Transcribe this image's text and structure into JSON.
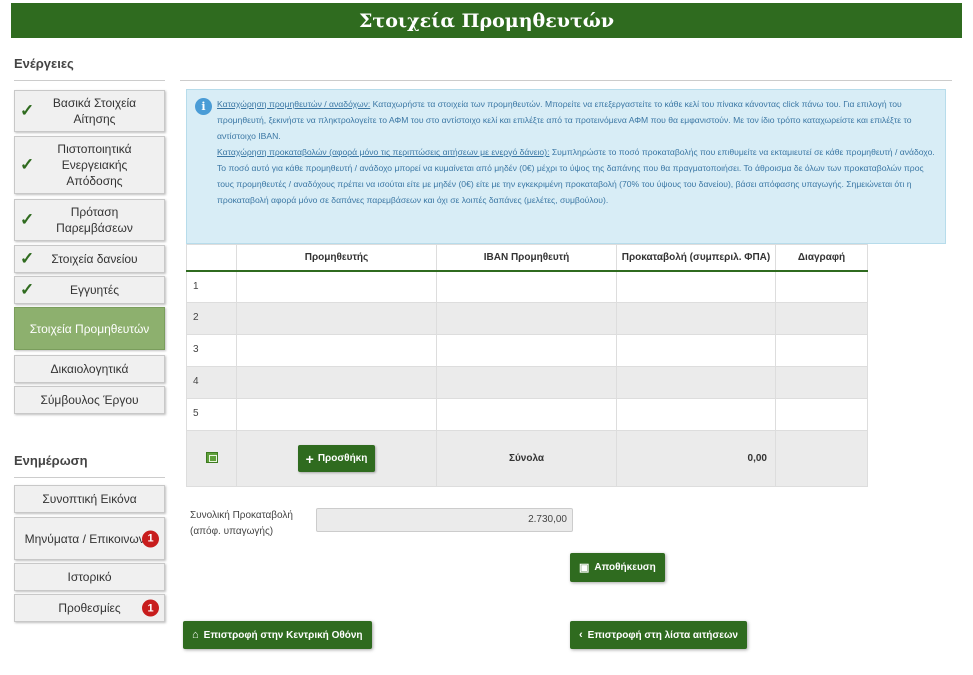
{
  "header": {
    "title": "Στοιχεία Προμηθευτών"
  },
  "sidebar": {
    "actions_title": "Ενέργειες",
    "actions": [
      {
        "label": "Βασικά Στοιχεία Αίτησης",
        "checked": true
      },
      {
        "label": "Πιστοποιητικά Ενεργειακής Απόδοσης",
        "checked": true
      },
      {
        "label": "Πρόταση Παρεμβάσεων",
        "checked": true
      },
      {
        "label": "Στοιχεία δανείου",
        "checked": true
      },
      {
        "label": "Εγγυητές",
        "checked": true
      },
      {
        "label": "Στοιχεία Προμηθευτών",
        "active": true
      },
      {
        "label": "Δικαιολογητικά"
      },
      {
        "label": "Σύμβουλος Έργου"
      }
    ],
    "info_title": "Ενημέρωση",
    "info_items": [
      {
        "label": "Συνοπτική Εικόνα"
      },
      {
        "label": "Μηνύματα / Επικοινωνία",
        "badge": "1"
      },
      {
        "label": "Ιστορικό"
      },
      {
        "label": "Προθεσμίες",
        "badge": "1"
      }
    ]
  },
  "info_box": {
    "p1_heading": "Καταχώρηση προμηθευτών / αναδόχων:",
    "p1_text": " Καταχωρήστε τα στοιχεία των προμηθευτών. Μπορείτε να επεξεργαστείτε το κάθε κελί του πίνακα κάνοντας click πάνω του. Για επιλογή του προμηθευτή, ξεκινήστε να πληκτρολογείτε το ΑΦΜ του στο αντίστοιχο κελί και επιλέξτε από τα προτεινόμενα ΑΦΜ που θα εμφανιστούν. Με τον ίδιο τρόπο καταχωρείστε και επιλέξτε το αντίστοιχο ΙΒΑΝ.",
    "p2_heading": "Καταχώρηση προκαταβολών (αφορά μόνο τις περιπτώσεις αιτήσεων με ενεργό δάνειο):",
    "p2_text": " Συμπληρώστε το ποσό προκαταβολής που επιθυμείτε να εκταμιευτεί σε κάθε προμηθευτή / ανάδοχο. Το ποσό αυτό για κάθε προμηθευτή / ανάδοχο μπορεί να κυμαίνεται από μηδέν (0€) μέχρι το ύψος της δαπάνης που θα πραγματοποιήσει. Το άθροισμα δε όλων των προκαταβολών προς τους προμηθευτές / αναδόχους πρέπει να ισούται είτε με μηδέν (0€) είτε με την εγκεκριμένη προκαταβολή (70% του ύψους του δανείου), βάσει απόφασης υπαγωγής. Σημειώνεται ότι η προκαταβολή αφορά μόνο σε δαπάνες παρεμβάσεων και όχι σε λοιπές δαπάνες (μελέτες, συμβούλου)."
  },
  "table": {
    "headers": [
      "",
      "Προμηθευτής",
      "IBAN Προμηθευτή",
      "Προκαταβολή (συμπεριλ. ΦΠΑ)",
      "Διαγραφή"
    ],
    "rows": [
      "1",
      "2",
      "3",
      "4",
      "5"
    ],
    "add_label": "Προσθήκη",
    "totals_label": "Σύνολα",
    "totals_value": "0,00"
  },
  "summary": {
    "label_line1": "Συνολική Προκαταβολή",
    "label_line2": "(απόφ. υπαγωγής)",
    "value": "2.730,00"
  },
  "buttons": {
    "save": "Αποθήκευση",
    "home": "Επιστροφή στην Κεντρική Οθόνη",
    "back_list": "Επιστροφή στη λίστα αιτήσεων"
  },
  "colors": {
    "brand_green": "#2f6b1f",
    "active_green": "#8db06e",
    "info_bg": "#d8edf6",
    "badge_red": "#c81d1d"
  }
}
